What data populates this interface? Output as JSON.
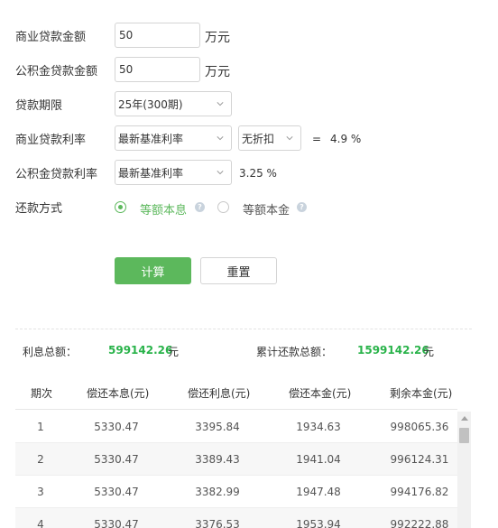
{
  "form": {
    "commercial_amount": {
      "label": "商业贷款金额",
      "value": "50",
      "unit": "万元"
    },
    "fund_amount": {
      "label": "公积金贷款金额",
      "value": "50",
      "unit": "万元"
    },
    "term": {
      "label": "贷款期限",
      "selected": "25年(300期)"
    },
    "commercial_rate": {
      "label": "商业贷款利率",
      "selected": "最新基准利率",
      "discount": "无折扣",
      "equals": "=",
      "result": "4.9 %"
    },
    "fund_rate": {
      "label": "公积金贷款利率",
      "selected": "最新基准利率",
      "result": "3.25 %"
    },
    "method": {
      "label": "还款方式",
      "options": [
        {
          "label": "等额本息",
          "checked": true
        },
        {
          "label": "等额本金",
          "checked": false
        }
      ]
    },
    "calc_button": "计算",
    "reset_button": "重置"
  },
  "summary": {
    "interest_label": "利息总额：",
    "interest_value": "599142.26",
    "interest_unit": "元",
    "total_label": "累计还款总额：",
    "total_value": "1599142.26",
    "total_unit": "元"
  },
  "table": {
    "columns": [
      "期次",
      "偿还本息(元)",
      "偿还利息(元)",
      "偿还本金(元)",
      "剩余本金(元)"
    ],
    "rows": [
      [
        "1",
        "5330.47",
        "3395.84",
        "1934.63",
        "998065.36"
      ],
      [
        "2",
        "5330.47",
        "3389.43",
        "1941.04",
        "996124.31"
      ],
      [
        "3",
        "5330.47",
        "3382.99",
        "1947.48",
        "994176.82"
      ],
      [
        "4",
        "5330.47",
        "3376.53",
        "1953.94",
        "992222.88"
      ]
    ]
  },
  "colors": {
    "accent": "#5cb85c",
    "value_green": "#29b34a"
  }
}
